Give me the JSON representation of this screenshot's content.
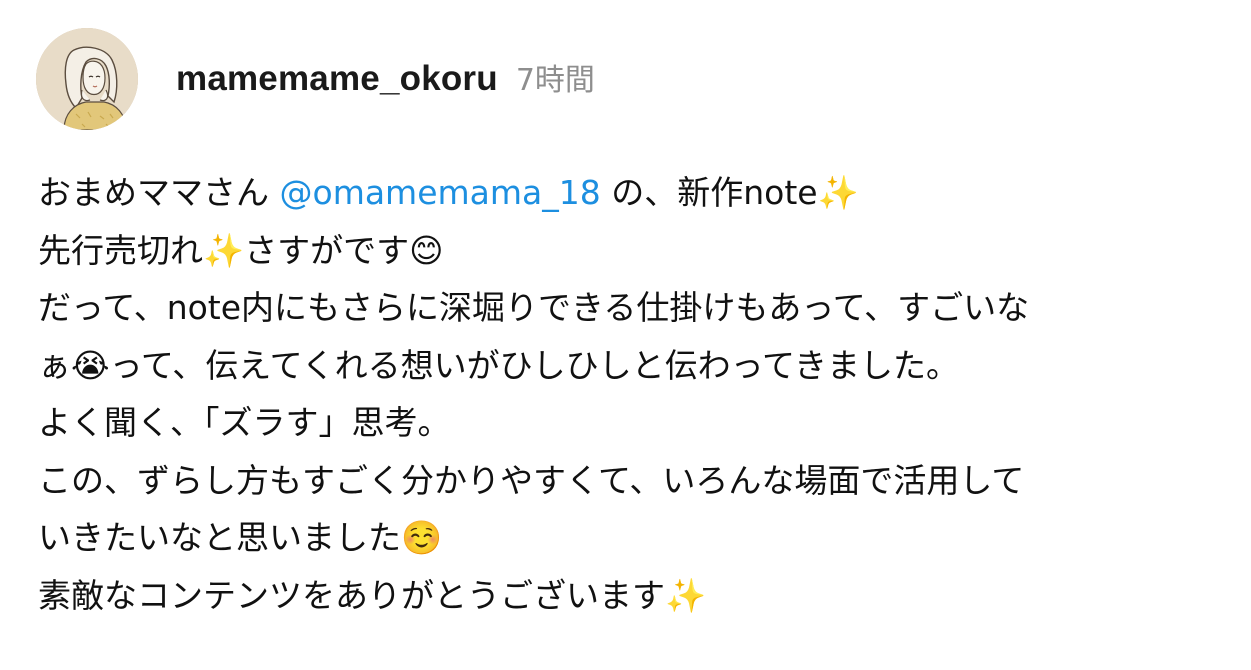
{
  "post": {
    "username": "mamemame_okoru",
    "timestamp": "7時間",
    "lines": [
      {
        "before": "おまめママさん ",
        "mention": "@omamemama_18",
        "after": " の、新作note",
        "emoji": "✨"
      },
      {
        "text": "先行売切れ",
        "emoji": "✨",
        "text2": "さすがです",
        "emoji2": "😊"
      },
      {
        "text": "だって、note内にもさらに深堀りできる仕掛けもあって、すごいな"
      },
      {
        "text": "ぁ",
        "emoji": "😭",
        "text2": "って、伝えてくれる想いがひしひしと伝わってきました。"
      },
      {
        "text": "よく聞く、「ズラす」思考。"
      },
      {
        "text": "この、ずらし方もすごく分かりやすくて、いろんな場面で活用して"
      },
      {
        "text": "いきたいなと思いました",
        "emoji": "☺️"
      },
      {
        "text": "素敵なコンテンツをありがとうございます",
        "emoji": "✨"
      }
    ]
  },
  "colors": {
    "mention": "#1d8fe0",
    "timestamp": "#8e8e8e",
    "text": "#111111"
  },
  "icons": {
    "avatar": "illustrated-woman-avatar"
  }
}
